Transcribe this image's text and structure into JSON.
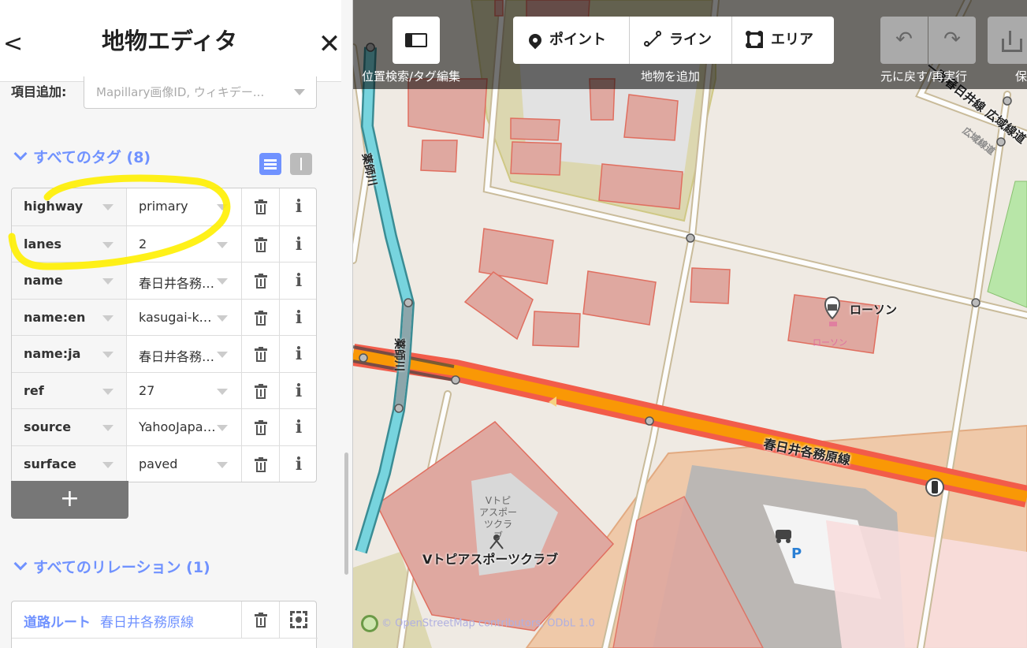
{
  "editor": {
    "title": "地物エディタ",
    "back_glyph": "<",
    "close_glyph": "✕"
  },
  "field_add": {
    "label": "項目追加:",
    "placeholder": "Mapillary画像ID, ウィキデー..."
  },
  "tags_section": {
    "title": "すべてのタグ (8)",
    "rows": [
      {
        "key": "highway",
        "value": "primary"
      },
      {
        "key": "lanes",
        "value": "2"
      },
      {
        "key": "name",
        "value": "春日井各務原線"
      },
      {
        "key": "name:en",
        "value": "kasugai-kakamigahara"
      },
      {
        "key": "name:ja",
        "value": "春日井各務原線"
      },
      {
        "key": "ref",
        "value": "27"
      },
      {
        "key": "source",
        "value": "YahooJapan/ALPSMAP"
      },
      {
        "key": "surface",
        "value": "paved"
      }
    ],
    "add_glyph": "+"
  },
  "relations_section": {
    "title": "すべてのリレーション (1)",
    "items": [
      {
        "type": "道路ルート",
        "name": "春日井各務原線"
      }
    ]
  },
  "toolbar": {
    "sidebar_toggle_label": "位置検索/タグ編集",
    "add_feature_label": "地物を追加",
    "history_label": "元に戻す/再実行",
    "save_label_partial": "保",
    "modes": [
      {
        "label": "ポイント",
        "icon": "point-icon"
      },
      {
        "label": "ライン",
        "icon": "line-icon"
      },
      {
        "label": "エリア",
        "icon": "area-icon"
      }
    ],
    "undo_glyph": "↶",
    "redo_glyph": "↷"
  },
  "map": {
    "road_label": "春日井各務原線",
    "river_label_1": "薬師川",
    "river_label_2": "薬師川",
    "highway_label": "一宮春日井線 広域線道",
    "highway_label_2": "広域線道",
    "poi_name": "ローソン",
    "poi_sub": "ローソン",
    "facility_label": "Vトピアスポーツクラブ",
    "facility_small": [
      "Vトピ",
      "アスポー",
      "ツクラ",
      "ブ"
    ],
    "parking_label": "P",
    "attribution": "© OpenStreetMap contributors, ODbL 1.0"
  },
  "colors": {
    "accent": "#7092ff",
    "highlight_marker": "#ffee00",
    "primary_road": "#f99806",
    "primary_casing": "#f25c4a",
    "river": "#77d4de",
    "building": "#e06e5f"
  }
}
